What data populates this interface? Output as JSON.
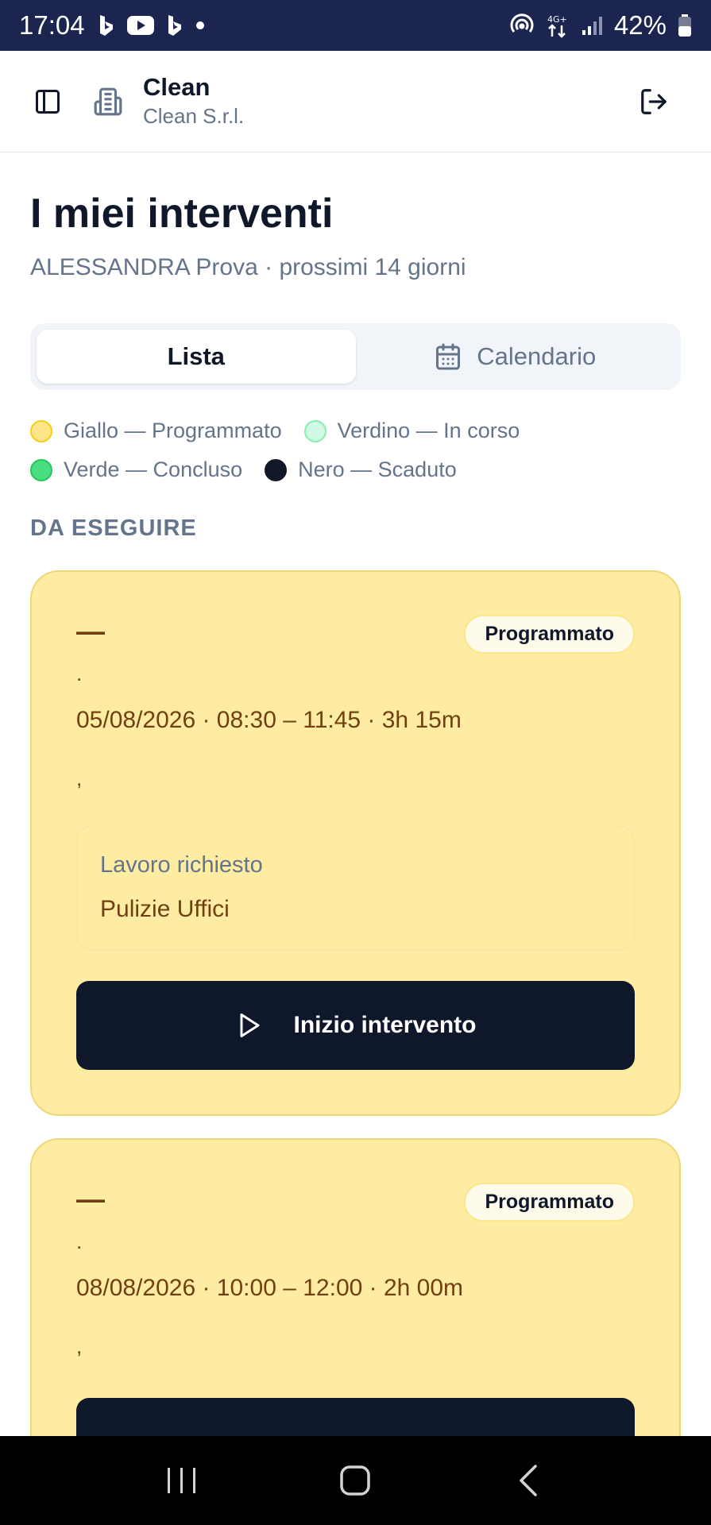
{
  "statusbar": {
    "time": "17:04",
    "battery": "42%",
    "network": "4G+",
    "icons": [
      "bing-icon",
      "youtube-icon",
      "bing-icon",
      "dot-icon",
      "hotspot-icon",
      "network-arrows-icon",
      "signal-icon",
      "battery-icon"
    ]
  },
  "header": {
    "org_name": "Clean",
    "org_subtitle": "Clean S.r.l."
  },
  "page": {
    "title": "I miei interventi",
    "subtitle": "ALESSANDRA Prova · prossimi 14 giorni"
  },
  "view_toggle": {
    "list_label": "Lista",
    "calendar_label": "Calendario",
    "selected": "Lista"
  },
  "legend": [
    {
      "label": "Giallo — Programmato",
      "color": "#fde68a",
      "border": "#facc15"
    },
    {
      "label": "Verdino — In corso",
      "color": "#d1fae5",
      "border": "#86efac"
    },
    {
      "label": "Verde — Concluso",
      "color": "#4ade80",
      "border": "#22c55e"
    },
    {
      "label": "Nero — Scaduto",
      "color": "#111827",
      "border": "#111827"
    }
  ],
  "section": {
    "title": "DA ESEGUIRE"
  },
  "cards": [
    {
      "name": "—",
      "dot": ".",
      "status": "Programmato",
      "datetime": "05/08/2026 · 08:30 – 11:45 · 3h 15m",
      "comma": ",",
      "work_label": "Lavoro richiesto",
      "work_value": "Pulizie Uffici",
      "button_label": "Inizio intervento"
    },
    {
      "name": "—",
      "dot": ".",
      "status": "Programmato",
      "datetime": "08/08/2026 · 10:00 – 12:00 · 2h 00m",
      "comma": ","
    }
  ],
  "colors": {
    "statusbar": "#1b2550",
    "card_bg": "#fdeca1",
    "primary_button": "#0f172a"
  }
}
